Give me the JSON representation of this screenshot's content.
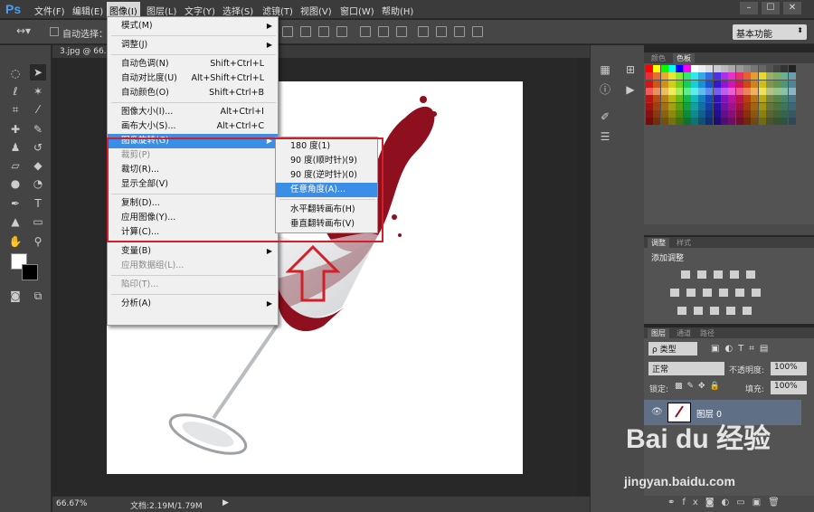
{
  "app": {
    "logo": "Ps"
  },
  "menubar": [
    "文件(F)",
    "编辑(E)",
    "图像(I)",
    "图层(L)",
    "文字(Y)",
    "选择(S)",
    "滤镜(T)",
    "视图(V)",
    "窗口(W)",
    "帮助(H)"
  ],
  "window_controls": [
    "–",
    "☐",
    "✕"
  ],
  "optbar": {
    "auto_select_label": "自动选择：",
    "workspace": "基本功能"
  },
  "document": {
    "tab_label": "3.jpg @ 66.7",
    "zoom": "66.67%",
    "doc_info": "文档:2.19M/1.79M"
  },
  "image_menu": {
    "items": [
      {
        "label": "模式(M)",
        "arrow": "▶",
        "state": "normal"
      },
      {
        "sep": true
      },
      {
        "label": "调整(J)",
        "arrow": "▶",
        "state": "normal"
      },
      {
        "sep": true
      },
      {
        "label": "自动色调(N)",
        "shortcut": "Shift+Ctrl+L",
        "state": "normal"
      },
      {
        "label": "自动对比度(U)",
        "shortcut": "Alt+Shift+Ctrl+L",
        "state": "normal"
      },
      {
        "label": "自动颜色(O)",
        "shortcut": "Shift+Ctrl+B",
        "state": "normal"
      },
      {
        "sep": true
      },
      {
        "label": "图像大小(I)...",
        "shortcut": "Alt+Ctrl+I",
        "state": "normal"
      },
      {
        "label": "画布大小(S)...",
        "shortcut": "Alt+Ctrl+C",
        "state": "normal"
      },
      {
        "label": "图像旋转(G)",
        "arrow": "▶",
        "state": "highlight"
      },
      {
        "label": "裁剪(P)",
        "state": "disabled"
      },
      {
        "label": "裁切(R)...",
        "state": "normal"
      },
      {
        "label": "显示全部(V)",
        "state": "normal"
      },
      {
        "sep": true
      },
      {
        "label": "复制(D)...",
        "state": "normal"
      },
      {
        "label": "应用图像(Y)...",
        "state": "normal"
      },
      {
        "label": "计算(C)...",
        "state": "normal"
      },
      {
        "sep": true
      },
      {
        "label": "变量(B)",
        "arrow": "▶",
        "state": "normal"
      },
      {
        "label": "应用数据组(L)...",
        "state": "disabled"
      },
      {
        "sep": true
      },
      {
        "label": "陷印(T)...",
        "state": "disabled"
      },
      {
        "sep": true
      },
      {
        "label": "分析(A)",
        "arrow": "▶",
        "state": "normal"
      }
    ]
  },
  "rotate_submenu": {
    "items": [
      {
        "label": "180 度(1)",
        "state": "normal"
      },
      {
        "label": "90 度(顺时针)(9)",
        "state": "normal"
      },
      {
        "label": "90 度(逆时针)(0)",
        "state": "normal"
      },
      {
        "label": "任意角度(A)...",
        "state": "highlight"
      },
      {
        "sep": true
      },
      {
        "label": "水平翻转画布(H)",
        "state": "normal"
      },
      {
        "label": "垂直翻转画布(V)",
        "state": "normal"
      }
    ]
  },
  "panels": {
    "swatch_tabs": [
      "颜色",
      "色板"
    ],
    "adjust_tabs": [
      "调整",
      "样式"
    ],
    "adjust_title": "添加调整",
    "layer_tabs": [
      "图层",
      "通道",
      "路径"
    ],
    "layer_kind": "ρ 类型",
    "blend_mode": "正常",
    "opacity_label": "不透明度:",
    "opacity_value": "100%",
    "lock_label": "锁定:",
    "fill_label": "填充:",
    "fill_value": "100%",
    "layer_name": "图层 0"
  },
  "colors": {
    "highlight": "#3b8ee8",
    "annotation": "#d2202a",
    "wine": "#8e0f1e"
  },
  "watermark": {
    "brand": "Bai du 经验",
    "url": "jingyan.baidu.com"
  }
}
